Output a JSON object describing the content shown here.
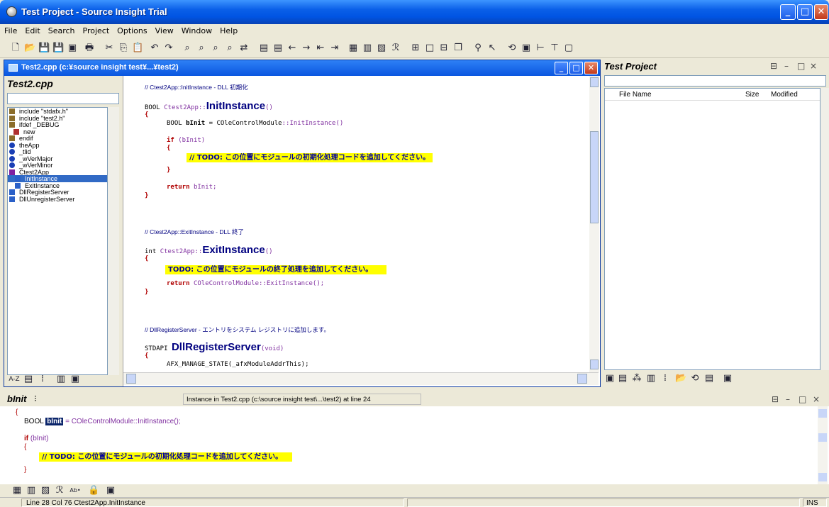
{
  "window": {
    "title": "Test Project - Source Insight Trial"
  },
  "menu": [
    "File",
    "Edit",
    "Search",
    "Project",
    "Options",
    "View",
    "Window",
    "Help"
  ],
  "editor": {
    "title": "Test2.cpp (c:¥source insight test¥...¥test2)",
    "symbol_panel_title": "Test2.cpp",
    "symbols": [
      {
        "label": "include \"stdafx.h\"",
        "icon": "include-icon"
      },
      {
        "label": "include \"test2.h\"",
        "icon": "include-icon"
      },
      {
        "label": "ifdef _DEBUG",
        "icon": "include-icon"
      },
      {
        "label": "new",
        "icon": "define-icon"
      },
      {
        "label": "endif",
        "icon": "include-icon"
      },
      {
        "label": "theApp",
        "icon": "variable-icon"
      },
      {
        "label": "_tlid",
        "icon": "variable-icon"
      },
      {
        "label": "_wVerMajor",
        "icon": "variable-icon"
      },
      {
        "label": "_wVerMinor",
        "icon": "variable-icon"
      },
      {
        "label": "Ctest2App",
        "icon": "class-icon"
      },
      {
        "label": "InitInstance",
        "icon": "method-icon"
      },
      {
        "label": "ExitInstance",
        "icon": "method-icon"
      },
      {
        "label": "DllRegisterServer",
        "icon": "function-icon"
      },
      {
        "label": "DllUnregisterServer",
        "icon": "function-icon"
      }
    ],
    "symbol_selected": "InitInstance",
    "code": {
      "c1": "// Ctest2App::InitInstance - DLL 初期化",
      "bool": "BOOL",
      "cls1": "Ctest2App",
      "sep": "::",
      "f1": "InitInstance",
      "paren": "()",
      "ob": "{",
      "cb": "}",
      "l_bool": "BOOL",
      "l_binit": "bInit",
      "l_eq": "=",
      "l_cole": "COleControlModule",
      "l_sep": "::",
      "l_init": "InitInstance",
      "l_paren": "()",
      "l_semi": ";",
      "if": "if",
      "if_cond": "(bInit)",
      "todo1": "// TODO: この位置にモジュールの初期化処理コードを追加してください。",
      "return": "return",
      "ret1": "bInit;",
      "c2": "// Ctest2App::ExitInstance - DLL 終了",
      "int": "int",
      "cls2": "Ctest2App",
      "f2": "ExitInstance",
      "todo2": "TODO: この位置にモジュールの終了処理を追加してください。",
      "ret2": "COleControlModule::ExitInstance();",
      "c3": "// DllRegisterServer - エントリをシステム レジストリに追加します。",
      "stdapi": "STDAPI",
      "f3": "DllRegisterServer",
      "void": "(void)",
      "afx": "AFX_MANAGE_STATE(_afxModuleAddrThis);"
    }
  },
  "project": {
    "title": "Test Project",
    "columns": [
      "File Name",
      "Size",
      "Modified"
    ]
  },
  "context": {
    "title": "bInit",
    "info": "Instance in Test2.cpp (c:\\source insight test\\...\\test2) at line 24",
    "brace": "{",
    "bool": "BOOL",
    "binit": "bInit",
    "rest": "= COleControlModule::InitInstance();",
    "if": "if",
    "cond": "(bInit)",
    "ob": "{",
    "todo": "// TODO: この位置にモジュールの初期化処理コードを追加してください。",
    "cb": "}"
  },
  "status": {
    "position": "Line 28  Col 76   Ctest2App.InitInstance",
    "mode": "INS"
  },
  "colors": {
    "titlebar": "#0054e3",
    "highlight": "#ffff00",
    "selection": "#316ac5"
  }
}
